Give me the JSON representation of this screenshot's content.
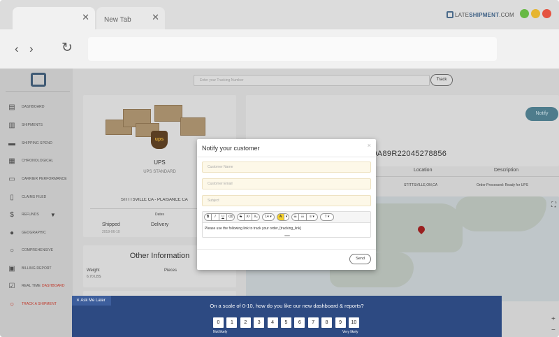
{
  "browser": {
    "tabs": [
      {
        "label": "",
        "close": "✕"
      },
      {
        "label": "New Tab",
        "close": "✕"
      }
    ],
    "brand_prefix": "LATE",
    "brand_suffix": "SHIPMENT",
    "brand_tld": ".COM",
    "back": "‹",
    "forward": "›",
    "reload": "↻",
    "window_dots": [
      "#67b944",
      "#e6b530",
      "#e55341"
    ]
  },
  "sidebar": {
    "items": [
      {
        "label": "DASHBOARD",
        "icon": "dashboard-icon",
        "glyph": "▤"
      },
      {
        "label": "SHIPMENTS",
        "icon": "bar-chart-icon",
        "glyph": "▥"
      },
      {
        "label": "SHIPPING SPEND",
        "icon": "truck-icon",
        "glyph": "▬"
      },
      {
        "label": "CHRONOLOGICAL",
        "icon": "calendar-icon",
        "glyph": "▦"
      },
      {
        "label": "CARRIER PERFORMANCE",
        "icon": "performance-icon",
        "glyph": "▭"
      },
      {
        "label": "CLAIMS FILED",
        "icon": "document-icon",
        "glyph": "▯"
      },
      {
        "label": "REFUNDS",
        "icon": "dollar-icon",
        "glyph": "$"
      },
      {
        "label": "GEOGRAPHIC",
        "icon": "globe-icon",
        "glyph": "●"
      },
      {
        "label": "COMPREHENSIVE",
        "icon": "search-icon",
        "glyph": "○"
      },
      {
        "label": "BILLING REPORT",
        "icon": "billing-icon",
        "glyph": "▣"
      },
      {
        "label": "REAL TIME",
        "label_red": "DASHBOARD",
        "icon": "checkbox-icon",
        "glyph": "☑"
      },
      {
        "label": "TRACK A SHIPMENT",
        "icon": "search-icon",
        "glyph": "○"
      }
    ],
    "refunds_caret": "▼"
  },
  "search": {
    "placeholder": "Enter your Tracking Number",
    "button": "Track"
  },
  "shipment": {
    "carrier": "UPS",
    "service": "UPS STANDARD",
    "route": "STITTSVILLE CA - PLAISANCE CA",
    "dates_label": "Dates",
    "shipped_label": "Shipped",
    "delivery_label": "Delivery",
    "ship_date": "2019-06-10",
    "logo_text": "ups"
  },
  "tracking": {
    "notify_button": "Notify",
    "number": "1Z0A89R22045278856",
    "columns": [
      "Location",
      "Description"
    ],
    "row": {
      "location": "STITTSVILLE,ON,CA",
      "description": "Order Processed: Ready for UPS"
    }
  },
  "other_info": {
    "title": "Other Information",
    "weight_label": "Weight",
    "weight_value": "6.70 LBS",
    "pieces_label": "Pieces"
  },
  "map_controls": {
    "fullscreen": "⛶",
    "zoom_in": "+",
    "zoom_out": "−"
  },
  "survey": {
    "ask_later": "✕  Ask Me Later",
    "question": "On a scale of 0-10, how do you like our new dashboard & reports?",
    "scale": [
      "0",
      "1",
      "2",
      "3",
      "4",
      "5",
      "6",
      "7",
      "8",
      "9",
      "10"
    ],
    "low_label": "Not likely",
    "high_label": "Very likely"
  },
  "modal": {
    "title": "Notify your customer",
    "close": "×",
    "name_placeholder": "Customer Name",
    "email_placeholder": "Customer Email",
    "subject_placeholder": "Subject",
    "toolbar": {
      "group1": [
        "B",
        "I",
        "U",
        "⌫"
      ],
      "group2": [
        "S",
        "X²",
        "X₂"
      ],
      "font_size": "14 ▾",
      "color": "A",
      "color_caret": "▾",
      "group3": [
        "☰",
        "☷",
        "≡ ▾"
      ],
      "table": "T ▾"
    },
    "body_text": "Please use the following link to track your order, [tracking_link]",
    "send": "Send"
  }
}
